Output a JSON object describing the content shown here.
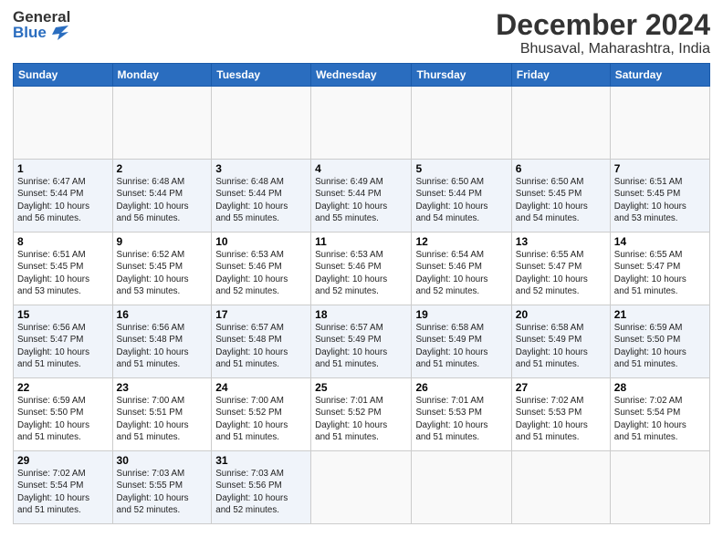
{
  "header": {
    "logo_general": "General",
    "logo_blue": "Blue",
    "title": "December 2024",
    "subtitle": "Bhusaval, Maharashtra, India"
  },
  "calendar": {
    "weekdays": [
      "Sunday",
      "Monday",
      "Tuesday",
      "Wednesday",
      "Thursday",
      "Friday",
      "Saturday"
    ],
    "weeks": [
      [
        {
          "day": "",
          "info": ""
        },
        {
          "day": "",
          "info": ""
        },
        {
          "day": "",
          "info": ""
        },
        {
          "day": "",
          "info": ""
        },
        {
          "day": "",
          "info": ""
        },
        {
          "day": "",
          "info": ""
        },
        {
          "day": "",
          "info": ""
        }
      ],
      [
        {
          "day": "1",
          "info": "Sunrise: 6:47 AM\nSunset: 5:44 PM\nDaylight: 10 hours\nand 56 minutes."
        },
        {
          "day": "2",
          "info": "Sunrise: 6:48 AM\nSunset: 5:44 PM\nDaylight: 10 hours\nand 56 minutes."
        },
        {
          "day": "3",
          "info": "Sunrise: 6:48 AM\nSunset: 5:44 PM\nDaylight: 10 hours\nand 55 minutes."
        },
        {
          "day": "4",
          "info": "Sunrise: 6:49 AM\nSunset: 5:44 PM\nDaylight: 10 hours\nand 55 minutes."
        },
        {
          "day": "5",
          "info": "Sunrise: 6:50 AM\nSunset: 5:44 PM\nDaylight: 10 hours\nand 54 minutes."
        },
        {
          "day": "6",
          "info": "Sunrise: 6:50 AM\nSunset: 5:45 PM\nDaylight: 10 hours\nand 54 minutes."
        },
        {
          "day": "7",
          "info": "Sunrise: 6:51 AM\nSunset: 5:45 PM\nDaylight: 10 hours\nand 53 minutes."
        }
      ],
      [
        {
          "day": "8",
          "info": "Sunrise: 6:51 AM\nSunset: 5:45 PM\nDaylight: 10 hours\nand 53 minutes."
        },
        {
          "day": "9",
          "info": "Sunrise: 6:52 AM\nSunset: 5:45 PM\nDaylight: 10 hours\nand 53 minutes."
        },
        {
          "day": "10",
          "info": "Sunrise: 6:53 AM\nSunset: 5:46 PM\nDaylight: 10 hours\nand 52 minutes."
        },
        {
          "day": "11",
          "info": "Sunrise: 6:53 AM\nSunset: 5:46 PM\nDaylight: 10 hours\nand 52 minutes."
        },
        {
          "day": "12",
          "info": "Sunrise: 6:54 AM\nSunset: 5:46 PM\nDaylight: 10 hours\nand 52 minutes."
        },
        {
          "day": "13",
          "info": "Sunrise: 6:55 AM\nSunset: 5:47 PM\nDaylight: 10 hours\nand 52 minutes."
        },
        {
          "day": "14",
          "info": "Sunrise: 6:55 AM\nSunset: 5:47 PM\nDaylight: 10 hours\nand 51 minutes."
        }
      ],
      [
        {
          "day": "15",
          "info": "Sunrise: 6:56 AM\nSunset: 5:47 PM\nDaylight: 10 hours\nand 51 minutes."
        },
        {
          "day": "16",
          "info": "Sunrise: 6:56 AM\nSunset: 5:48 PM\nDaylight: 10 hours\nand 51 minutes."
        },
        {
          "day": "17",
          "info": "Sunrise: 6:57 AM\nSunset: 5:48 PM\nDaylight: 10 hours\nand 51 minutes."
        },
        {
          "day": "18",
          "info": "Sunrise: 6:57 AM\nSunset: 5:49 PM\nDaylight: 10 hours\nand 51 minutes."
        },
        {
          "day": "19",
          "info": "Sunrise: 6:58 AM\nSunset: 5:49 PM\nDaylight: 10 hours\nand 51 minutes."
        },
        {
          "day": "20",
          "info": "Sunrise: 6:58 AM\nSunset: 5:49 PM\nDaylight: 10 hours\nand 51 minutes."
        },
        {
          "day": "21",
          "info": "Sunrise: 6:59 AM\nSunset: 5:50 PM\nDaylight: 10 hours\nand 51 minutes."
        }
      ],
      [
        {
          "day": "22",
          "info": "Sunrise: 6:59 AM\nSunset: 5:50 PM\nDaylight: 10 hours\nand 51 minutes."
        },
        {
          "day": "23",
          "info": "Sunrise: 7:00 AM\nSunset: 5:51 PM\nDaylight: 10 hours\nand 51 minutes."
        },
        {
          "day": "24",
          "info": "Sunrise: 7:00 AM\nSunset: 5:52 PM\nDaylight: 10 hours\nand 51 minutes."
        },
        {
          "day": "25",
          "info": "Sunrise: 7:01 AM\nSunset: 5:52 PM\nDaylight: 10 hours\nand 51 minutes."
        },
        {
          "day": "26",
          "info": "Sunrise: 7:01 AM\nSunset: 5:53 PM\nDaylight: 10 hours\nand 51 minutes."
        },
        {
          "day": "27",
          "info": "Sunrise: 7:02 AM\nSunset: 5:53 PM\nDaylight: 10 hours\nand 51 minutes."
        },
        {
          "day": "28",
          "info": "Sunrise: 7:02 AM\nSunset: 5:54 PM\nDaylight: 10 hours\nand 51 minutes."
        }
      ],
      [
        {
          "day": "29",
          "info": "Sunrise: 7:02 AM\nSunset: 5:54 PM\nDaylight: 10 hours\nand 51 minutes."
        },
        {
          "day": "30",
          "info": "Sunrise: 7:03 AM\nSunset: 5:55 PM\nDaylight: 10 hours\nand 52 minutes."
        },
        {
          "day": "31",
          "info": "Sunrise: 7:03 AM\nSunset: 5:56 PM\nDaylight: 10 hours\nand 52 minutes."
        },
        {
          "day": "",
          "info": ""
        },
        {
          "day": "",
          "info": ""
        },
        {
          "day": "",
          "info": ""
        },
        {
          "day": "",
          "info": ""
        }
      ]
    ]
  }
}
